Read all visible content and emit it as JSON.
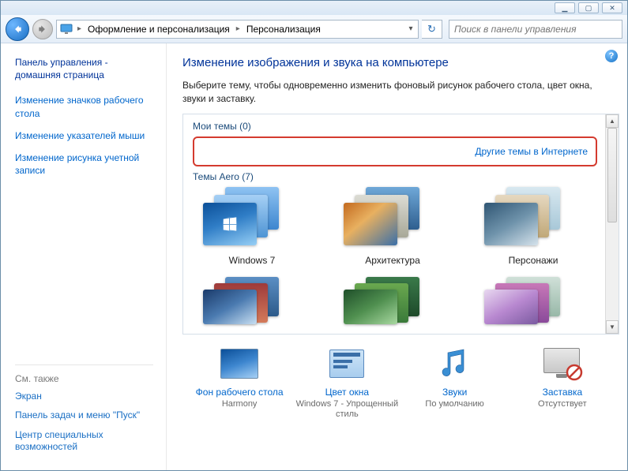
{
  "titlebar": {
    "min": "▁",
    "max": "▢",
    "close": "✕"
  },
  "nav": {
    "crumb1": "Оформление и персонализация",
    "crumb2": "Персонализация",
    "search_placeholder": "Поиск в панели управления"
  },
  "sidebar": {
    "home": "Панель управления - домашняя страница",
    "links": [
      "Изменение значков рабочего стола",
      "Изменение указателей мыши",
      "Изменение рисунка учетной записи"
    ],
    "seealso_h": "См. также",
    "seealso": [
      "Экран",
      "Панель задач и меню \"Пуск\"",
      "Центр специальных возможностей"
    ]
  },
  "main": {
    "title": "Изменение изображения и звука на компьютере",
    "desc": "Выберите тему, чтобы одновременно изменить фоновый рисунок рабочего стола, цвет окна, звуки и заставку.",
    "my_themes": "Мои темы (0)",
    "online_link": "Другие темы в Интернете",
    "aero_h": "Темы Aero (7)",
    "aero": [
      "Windows 7",
      "Архитектура",
      "Персонажи"
    ]
  },
  "bottom": {
    "bg_t": "Фон рабочего стола",
    "bg_s": "Harmony",
    "color_t": "Цвет окна",
    "color_s": "Windows 7 - Упрощенный стиль",
    "sound_t": "Звуки",
    "sound_s": "По умолчанию",
    "saver_t": "Заставка",
    "saver_s": "Отсутствует"
  }
}
